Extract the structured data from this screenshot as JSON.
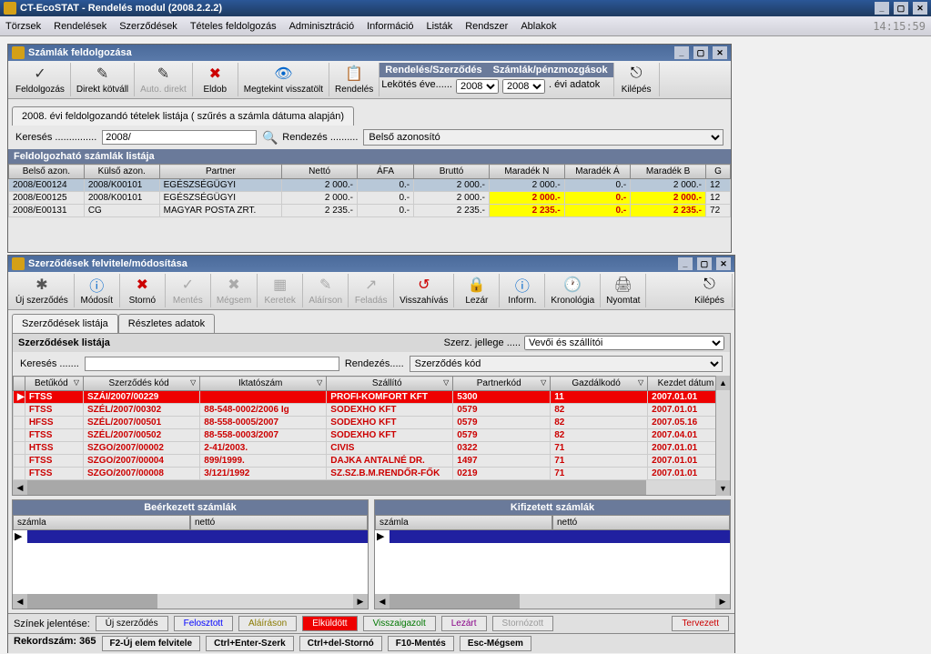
{
  "app": {
    "title": "CT-EcoSTAT - Rendelés modul (2008.2.2.2)",
    "clock": "14:15:59"
  },
  "menu": [
    "Törzsek",
    "Rendelések",
    "Szerződések",
    "Tételes feldolgozás",
    "Adminisztráció",
    "Információ",
    "Listák",
    "Rendszer",
    "Ablakok"
  ],
  "win1": {
    "title": "Számlák feldolgozása",
    "toolbar": [
      {
        "label": "Feldolgozás",
        "icon": "✓"
      },
      {
        "label": "Direkt kötváll",
        "icon": "✎"
      },
      {
        "label": "Auto. direkt",
        "icon": "✎",
        "disabled": true
      },
      {
        "label": "Eldob",
        "icon": "✖",
        "color": "#c00"
      },
      {
        "label": "Megtekint visszatölt",
        "icon": "👁",
        "color": "#06c"
      },
      {
        "label": "Rendelés",
        "icon": "📋"
      }
    ],
    "year_headers": [
      "Rendelés/Szerződés",
      "Számlák/pénzmozgások"
    ],
    "lekotes": "Lekötés éve......",
    "year1": "2008",
    "year2": "2008",
    "evi_adatok": ". évi adatok",
    "kilepes": "Kilépés",
    "tab": "2008. évi feldolgozandó tételek listája ( szűrés a számla dátuma alapján)",
    "kereses": "Keresés ...............",
    "kereses_val": "2008/",
    "rendezes": "Rendezés ..........",
    "rendezes_val": "Belső azonosító",
    "section": "Feldolgozható számlák listája",
    "cols": [
      "Belső azon.",
      "Külső azon.",
      "Partner",
      "Nettó",
      "ÁFA",
      "Bruttó",
      "Maradék N",
      "Maradék Á",
      "Maradék B",
      "G"
    ],
    "rows": [
      {
        "sel": true,
        "c": [
          "2008/E00124",
          "2008/K00101",
          "EGÉSZSÉGÜGYI",
          "2 000.-",
          "0.-",
          "2 000.-",
          "2 000.-",
          "0.-",
          "2 000.-",
          "12"
        ]
      },
      {
        "ylw": true,
        "c": [
          "2008/E00125",
          "2008/K00101",
          "EGÉSZSÉGÜGYI",
          "2 000.-",
          "0.-",
          "2 000.-",
          "2 000.-",
          "0.-",
          "2 000.-",
          "12"
        ]
      },
      {
        "ylw": true,
        "c": [
          "2008/E00131",
          "CG",
          "MAGYAR POSTA ZRT.",
          "2 235.-",
          "0.-",
          "2 235.-",
          "2 235.-",
          "0.-",
          "2 235.-",
          "72"
        ]
      }
    ]
  },
  "win2": {
    "title": "Szerződések felvitele/módosítása",
    "toolbar": [
      {
        "label": "Új szerződés",
        "icon": "✱"
      },
      {
        "label": "Módosít",
        "icon": "ⓘ",
        "color": "#06c"
      },
      {
        "label": "Stornó",
        "icon": "✖",
        "color": "#c00"
      },
      {
        "label": "Mentés",
        "icon": "✓",
        "disabled": true
      },
      {
        "label": "Mégsem",
        "icon": "✖",
        "disabled": true
      },
      {
        "label": "Keretek",
        "icon": "▦",
        "disabled": true
      },
      {
        "label": "Aláírson",
        "icon": "✎",
        "disabled": true
      },
      {
        "label": "Feladás",
        "icon": "↗",
        "disabled": true
      },
      {
        "label": "Visszahívás",
        "icon": "↺",
        "color": "#c00"
      },
      {
        "label": "Lezár",
        "icon": "🔒"
      },
      {
        "label": "Inform.",
        "icon": "ⓘ",
        "color": "#06c"
      },
      {
        "label": "Kronológia",
        "icon": "🕐"
      },
      {
        "label": "Nyomtat",
        "icon": "🖨"
      }
    ],
    "kilepes": "Kilépés",
    "tabs": [
      "Szerződések listája",
      "Részletes adatok"
    ],
    "section": "Szerződések listája",
    "szerz_jellege": "Szerz. jellege .....",
    "szerz_jellege_val": "Vevői és szállítói",
    "kereses": "Keresés .......",
    "rendezes": "Rendezés.....",
    "rendezes_val": "Szerződés kód",
    "cols": [
      "Betűkód",
      "Szerződés kód",
      "Iktatószám",
      "Szállító",
      "Partnerkód",
      "Gazdálkodó",
      "Kezdet dátum"
    ],
    "rows": [
      {
        "redrow": true,
        "c": [
          "FTSS",
          "SZÁI/2007/00229",
          "",
          "PROFI-KOMFORT KFT",
          "5300",
          "11",
          "2007.01.01"
        ]
      },
      {
        "c": [
          "FTSS",
          "SZÉL/2007/00302",
          "88-548-0002/2006 Ig",
          "SODEXHO KFT",
          "0579",
          "82",
          "2007.01.01"
        ]
      },
      {
        "c": [
          "HFSS",
          "SZÉL/2007/00501",
          "88-558-0005/2007",
          "SODEXHO KFT",
          "0579",
          "82",
          "2007.05.16"
        ]
      },
      {
        "c": [
          "FTSS",
          "SZÉL/2007/00502",
          "88-558-0003/2007",
          "SODEXHO KFT",
          "0579",
          "82",
          "2007.04.01"
        ]
      },
      {
        "c": [
          "HTSS",
          "SZGO/2007/00002",
          "2-41/2003.",
          "CIVIS",
          "0322",
          "71",
          "2007.01.01"
        ]
      },
      {
        "c": [
          "FTSS",
          "SZGO/2007/00004",
          "899/1999.",
          "DAJKA ANTALNÉ DR.",
          "1497",
          "71",
          "2007.01.01"
        ]
      },
      {
        "c": [
          "FTSS",
          "SZGO/2007/00008",
          "3/121/1992",
          "SZ.SZ.B.M.RENDŐR-FŐK",
          "0219",
          "71",
          "2007.01.01"
        ]
      }
    ],
    "panel1": "Beérkezett számlák",
    "panel2": "Kifizetett számlák",
    "ph_szamla": "számla",
    "ph_netto": "nettó",
    "legend_label": "Színek jelentése:",
    "legend": {
      "uj": "Új szerződés",
      "fel": "Felosztott",
      "ala": "Aláíráson",
      "elk": "Elküldött",
      "vis": "Visszaigazolt",
      "lez": "Lezárt",
      "sto": "Stornózott",
      "ter": "Tervezett"
    },
    "rekord": "Rekordszám: 365",
    "shortcuts": [
      "F2-Új elem felvitele",
      "Ctrl+Enter-Szerk",
      "Ctrl+del-Stornó",
      "F10-Mentés",
      "Esc-Mégsem"
    ]
  }
}
